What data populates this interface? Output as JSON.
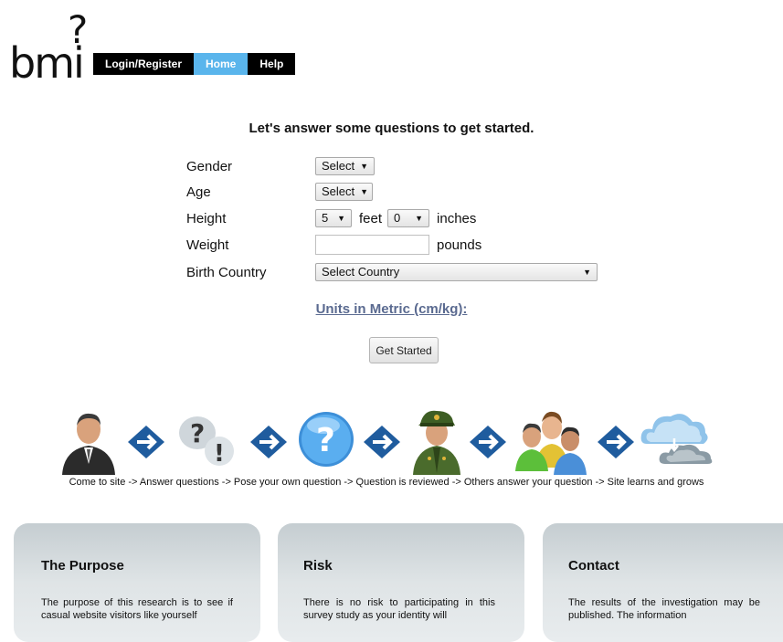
{
  "logo": {
    "text": "bmi",
    "mark": "?"
  },
  "nav": {
    "items": [
      "Login/Register",
      "Home",
      "Help"
    ]
  },
  "intro": "Let's answer some questions to get started.",
  "form": {
    "gender": {
      "label": "Gender",
      "value": "Select"
    },
    "age": {
      "label": "Age",
      "value": "Select"
    },
    "height": {
      "label": "Height",
      "feet_value": "5",
      "feet_unit": "feet",
      "inches_value": "0",
      "inches_unit": "inches"
    },
    "weight": {
      "label": "Weight",
      "value": "",
      "unit": "pounds"
    },
    "country": {
      "label": "Birth Country",
      "value": "Select Country"
    }
  },
  "metric_link": "Units in Metric (cm/kg):",
  "start_button": "Get Started",
  "flow": {
    "icons": [
      "businessman-icon",
      "arrow-icon",
      "question-bubbles-icon",
      "arrow-icon",
      "question-orb-icon",
      "arrow-icon",
      "officer-icon",
      "arrow-icon",
      "group-icon",
      "arrow-icon",
      "cloud-sync-icon"
    ],
    "caption": "Come to site -> Answer questions -> Pose your own question -> Question is reviewed -> Others answer your question -> Site learns and grows"
  },
  "cards": [
    {
      "title": "The Purpose",
      "text": "The purpose of this research is to see if casual website visitors like yourself"
    },
    {
      "title": "Risk",
      "text": "There is no risk to participating in this survey study as your identity will"
    },
    {
      "title": "Contact",
      "text": "The results of the investigation may be published. The information"
    }
  ],
  "colors": {
    "nav_bg": "#000000",
    "nav_active": "#5ab5ec",
    "metric_link": "#5a6a90",
    "arrow": "#1f5c9e"
  }
}
